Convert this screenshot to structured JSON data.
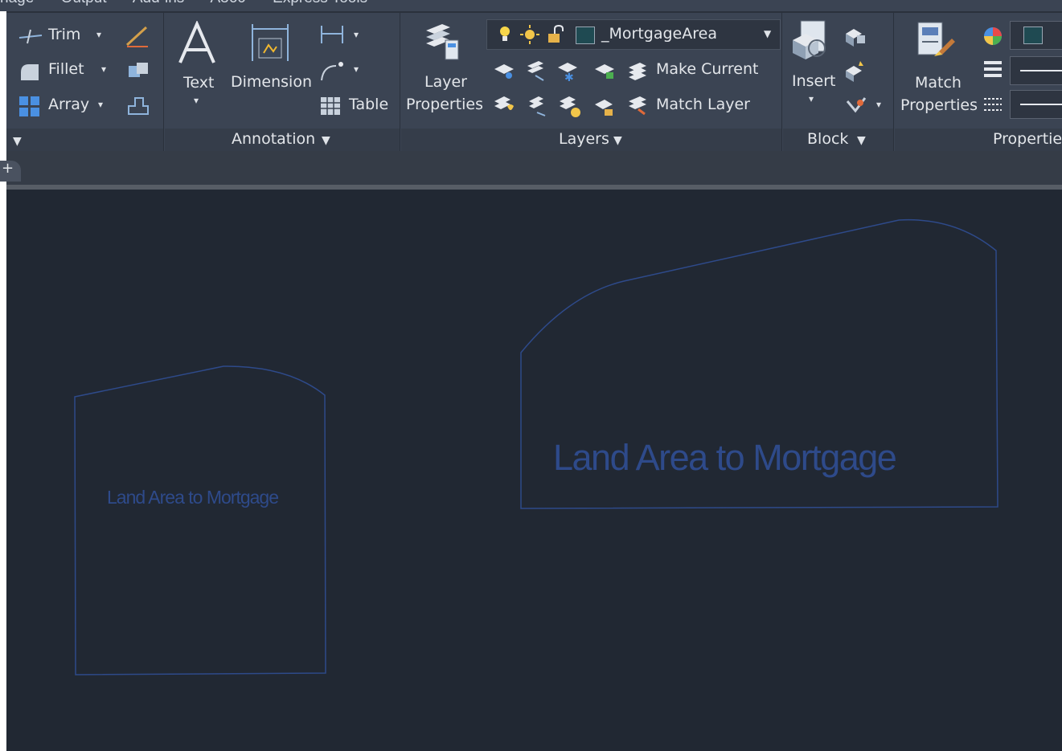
{
  "ribbon_tabs": [
    "nage",
    "Output",
    "Add-ins",
    "A360",
    "Express Tools"
  ],
  "modify": {
    "trim": "Trim",
    "fillet": "Fillet",
    "array": "Array"
  },
  "annotation": {
    "text": "Text",
    "dimension": "Dimension",
    "table": "Table",
    "panel_title": "Annotation"
  },
  "layers": {
    "layer_properties_line1": "Layer",
    "layer_properties_line2": "Properties",
    "current_layer": "_MortgageArea",
    "make_current": "Make Current",
    "match_layer": "Match Layer",
    "panel_title": "Layers"
  },
  "block": {
    "insert": "Insert",
    "panel_title": "Block"
  },
  "properties": {
    "match_line1": "Match",
    "match_line2": "Properties",
    "panel_title": "Propertie"
  },
  "drawing": {
    "label_small": "Land Area to Mortgage",
    "label_large": "Land Area to Mortgage",
    "outline_color": "#2e4a8a"
  },
  "colors": {
    "ribbon_bg": "#3b4453",
    "canvas_bg": "#212833",
    "layer_swatch": "#1f4a52"
  }
}
